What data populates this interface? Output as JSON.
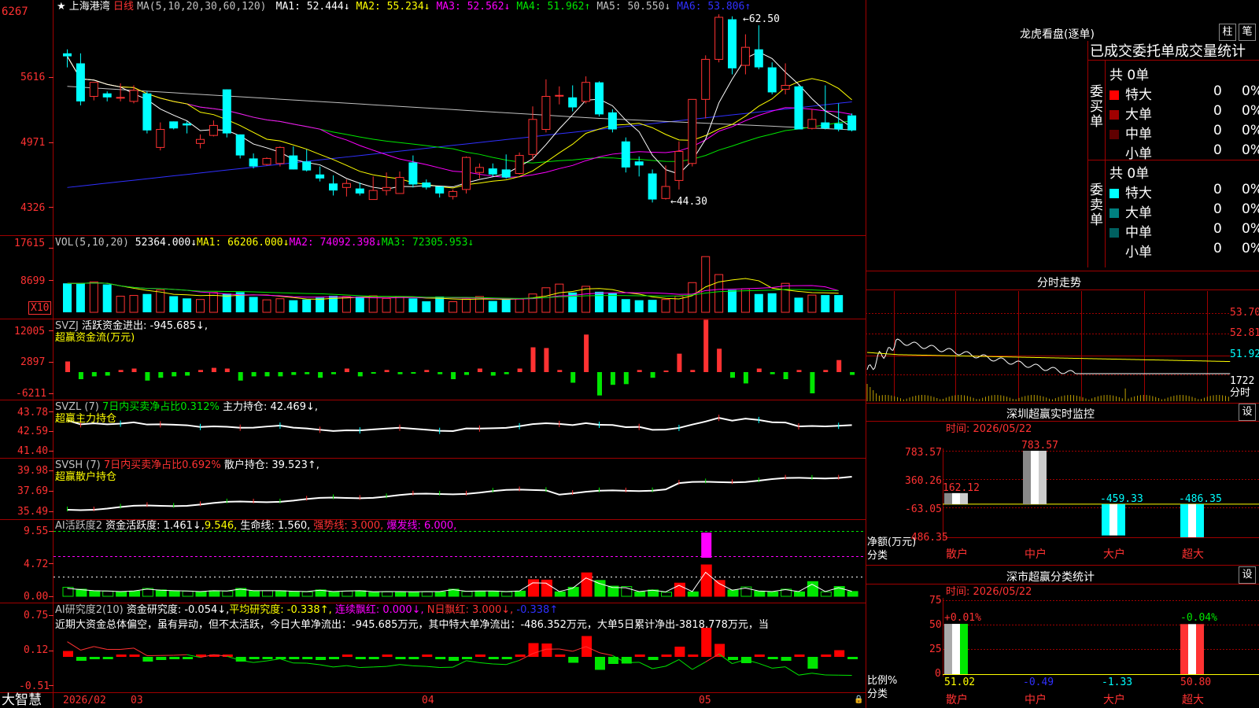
{
  "stock": {
    "name": "上海港湾",
    "star": "★",
    "period": "日线"
  },
  "ma_header": {
    "label": "MA(5,10,20,30,60,120)",
    "items": [
      {
        "text": "MA1: 52.444↓",
        "color": "#ffffff"
      },
      {
        "text": "MA2: 55.234↓",
        "color": "#ffff00"
      },
      {
        "text": "MA3: 52.562↓",
        "color": "#ff00ff"
      },
      {
        "text": "MA4: 51.962↑",
        "color": "#00e600"
      },
      {
        "text": "MA5: 50.550↓",
        "color": "#c0c0c0"
      },
      {
        "text": "MA6: 53.806↑",
        "color": "#3030ff"
      }
    ]
  },
  "price_axis": [
    "6267",
    "5616",
    "4971",
    "4326"
  ],
  "price_marks": {
    "high": "62.50",
    "low": "44.30"
  },
  "vol_header": {
    "label": "VOL(5,10,20)",
    "value": "52364.000↓",
    "ma1": "MA1: 66206.000↓",
    "ma2": "MA2: 74092.398↓",
    "ma3": "MA3: 72305.953↓"
  },
  "vol_axis": [
    "17615",
    "8699"
  ],
  "vol_unit": "X10",
  "svzj": {
    "label": "SVZJ",
    "text": "活跃资金进出: -945.685↓,",
    "title": "超赢资金流(万元)",
    "axis": [
      "12005",
      "2897",
      "-6211"
    ]
  },
  "svzl": {
    "label": "SVZL (7)",
    "ratio": "7日内买卖净占比0.312%",
    "pos": "主力持仓: 42.469↓,",
    "title": "超赢主力持仓",
    "axis": [
      "43.78",
      "42.59",
      "41.40"
    ]
  },
  "svsh": {
    "label": "SVSH (7)",
    "ratio": "7日内买卖净占比0.692%",
    "pos": "散户持仓: 39.523↑,",
    "title": "超赢散户持仓",
    "axis": [
      "39.98",
      "37.69",
      "35.49"
    ]
  },
  "ai_act": {
    "label": "AI活跃度2",
    "a": "资金活跃度: 1.461↓,",
    "b": "9.546,",
    "c": "生命线: 1.560,",
    "d": "强势线: 3.000,",
    "e": "爆发线: 6.000,",
    "axis": [
      "9.55",
      "4.72",
      "0.00"
    ]
  },
  "ai_res": {
    "label": "AI研究度2(10)",
    "a": "资金研究度: -0.054↓,",
    "b": "平均研究度: -0.338↑,",
    "c": "连续飘红: 0.000↓,",
    "d": "N日飘红: 3.000↓,",
    "e": "-0.338↑",
    "axis": [
      "0.75",
      "0.12",
      "-0.51"
    ],
    "note": "近期大资金总体偏空，虽有异动，但不太活跃，今日大单净流出：-945.685万元，其中特大单净流出：-486.352万元，大单5日累计净出-3818.778万元，当"
  },
  "bottom": {
    "brand": "大智慧",
    "dates": [
      "2026/02",
      "03",
      "04",
      "05"
    ]
  },
  "longhu": {
    "title": "龙虎看盘(逐单)",
    "btn1": "柱",
    "btn2": "笔",
    "subtitle": "已成交委托单成交量统计",
    "buy": {
      "side": "委买单",
      "total": "共 0单",
      "rows": [
        {
          "name": "特大",
          "count": "0",
          "pct": "0%",
          "color": "#ff0000"
        },
        {
          "name": "大单",
          "count": "0",
          "pct": "0%",
          "color": "#a00000"
        },
        {
          "name": "中单",
          "count": "0",
          "pct": "0%",
          "color": "#600000"
        },
        {
          "name": "小单",
          "count": "0",
          "pct": "0%",
          "color": "#000000"
        }
      ]
    },
    "sell": {
      "side": "委卖单",
      "total": "共 0单",
      "rows": [
        {
          "name": "特大",
          "count": "0",
          "pct": "0%",
          "color": "#00ffff"
        },
        {
          "name": "大单",
          "count": "0",
          "pct": "0%",
          "color": "#008080"
        },
        {
          "name": "中单",
          "count": "0",
          "pct": "0%",
          "color": "#006060"
        },
        {
          "name": "小单",
          "count": "0",
          "pct": "0%",
          "color": "#000000"
        }
      ]
    }
  },
  "fenshi": {
    "title": "分时走势",
    "axis": [
      "53.70",
      "52.81",
      "51.92",
      "1722",
      "分时"
    ]
  },
  "monitor": {
    "title": "深圳超赢实时监控",
    "btn": "设",
    "time": "时间: 2026/05/22",
    "axis": [
      "783.57",
      "360.26",
      "-63.05",
      "-486.35"
    ],
    "ylabel": "净额(万元)",
    "xlabel": "分类",
    "bars": [
      {
        "cat": "散户",
        "value": 162.12,
        "label": "162.12"
      },
      {
        "cat": "中户",
        "value": 783.57,
        "label": "783.57"
      },
      {
        "cat": "大户",
        "value": -459.33,
        "label": "-459.33"
      },
      {
        "cat": "超大",
        "value": -486.35,
        "label": "-486.35"
      }
    ]
  },
  "classstat": {
    "title": "深市超赢分类统计",
    "btn": "设",
    "time": "时间: 2026/05/22",
    "axis": [
      "75",
      "50",
      "25",
      "0"
    ],
    "ylabel": "比例%",
    "xlabel": "分类",
    "top": [
      {
        "cat": "散户",
        "label": "+0.01%"
      },
      {
        "cat": "超大",
        "label": "-0.04%"
      }
    ],
    "bars": [
      {
        "cat": "散户",
        "value": 51.02,
        "label": "51.02"
      },
      {
        "cat": "中户",
        "value": -0.49,
        "label": "-0.49"
      },
      {
        "cat": "大户",
        "value": -1.33,
        "label": "-1.33"
      },
      {
        "cat": "超大",
        "value": 50.8,
        "label": "50.80"
      }
    ]
  },
  "chart_data": {
    "type": "candlestick",
    "candles": [
      {
        "o": 58.6,
        "c": 58.3,
        "h": 59.0,
        "l": 57.2
      },
      {
        "o": 57.6,
        "c": 53.8,
        "h": 58.6,
        "l": 53.4
      },
      {
        "o": 54.3,
        "c": 55.7,
        "h": 55.7,
        "l": 53.9
      },
      {
        "o": 54.6,
        "c": 54.2,
        "h": 54.8,
        "l": 53.8
      },
      {
        "o": 54.2,
        "c": 54.2,
        "h": 55.6,
        "l": 53.8
      },
      {
        "o": 53.8,
        "c": 54.9,
        "h": 55.4,
        "l": 53.6
      },
      {
        "o": 54.6,
        "c": 50.9,
        "h": 54.8,
        "l": 50.6
      },
      {
        "o": 49.2,
        "c": 51.0,
        "h": 51.7,
        "l": 48.9
      },
      {
        "o": 51.8,
        "c": 51.1,
        "h": 51.8,
        "l": 51.0
      },
      {
        "o": 51.6,
        "c": 51.4,
        "h": 51.8,
        "l": 50.6
      },
      {
        "o": 49.6,
        "c": 50.0,
        "h": 50.5,
        "l": 49.1
      },
      {
        "o": 50.4,
        "c": 51.4,
        "h": 51.9,
        "l": 50.3
      },
      {
        "o": 55.0,
        "c": 50.6,
        "h": 55.0,
        "l": 50.2
      },
      {
        "o": 50.5,
        "c": 48.4,
        "h": 50.5,
        "l": 48.1
      },
      {
        "o": 48.1,
        "c": 47.3,
        "h": 48.6,
        "l": 47.1
      },
      {
        "o": 47.5,
        "c": 48.1,
        "h": 48.2,
        "l": 47.4
      },
      {
        "o": 47.6,
        "c": 49.2,
        "h": 49.3,
        "l": 47.3
      },
      {
        "o": 48.4,
        "c": 47.0,
        "h": 49.3,
        "l": 47.0
      },
      {
        "o": 47.8,
        "c": 46.9,
        "h": 49.0,
        "l": 46.8
      },
      {
        "o": 46.5,
        "c": 46.1,
        "h": 47.3,
        "l": 45.8
      },
      {
        "o": 45.6,
        "c": 44.9,
        "h": 46.4,
        "l": 44.4
      },
      {
        "o": 45.2,
        "c": 45.6,
        "h": 46.0,
        "l": 44.3
      },
      {
        "o": 45.1,
        "c": 44.6,
        "h": 45.7,
        "l": 44.4
      },
      {
        "o": 44.0,
        "c": 44.9,
        "h": 46.3,
        "l": 44.0
      },
      {
        "o": 44.9,
        "c": 45.2,
        "h": 46.7,
        "l": 44.4
      },
      {
        "o": 44.6,
        "c": 46.2,
        "h": 46.8,
        "l": 44.6
      },
      {
        "o": 47.7,
        "c": 45.5,
        "h": 48.4,
        "l": 45.2
      },
      {
        "o": 45.7,
        "c": 45.2,
        "h": 46.0,
        "l": 45.0
      },
      {
        "o": 45.3,
        "c": 44.6,
        "h": 45.3,
        "l": 44.2
      },
      {
        "o": 44.3,
        "c": 44.8,
        "h": 45.0,
        "l": 44.0
      },
      {
        "o": 45.0,
        "c": 48.2,
        "h": 48.3,
        "l": 44.6
      },
      {
        "o": 46.7,
        "c": 47.2,
        "h": 47.6,
        "l": 46.1
      },
      {
        "o": 47.1,
        "c": 46.5,
        "h": 47.6,
        "l": 46.3
      },
      {
        "o": 47.0,
        "c": 46.2,
        "h": 48.5,
        "l": 46.1
      },
      {
        "o": 46.6,
        "c": 48.4,
        "h": 48.7,
        "l": 46.5
      },
      {
        "o": 48.5,
        "c": 52.0,
        "h": 53.3,
        "l": 47.9
      },
      {
        "o": 51.0,
        "c": 54.3,
        "h": 56.0,
        "l": 50.7
      },
      {
        "o": 54.4,
        "c": 54.4,
        "h": 55.3,
        "l": 53.5
      },
      {
        "o": 54.2,
        "c": 53.2,
        "h": 55.4,
        "l": 52.8
      },
      {
        "o": 53.8,
        "c": 55.7,
        "h": 56.3,
        "l": 53.6
      },
      {
        "o": 55.7,
        "c": 52.5,
        "h": 55.8,
        "l": 52.3
      },
      {
        "o": 52.7,
        "c": 51.0,
        "h": 53.0,
        "l": 50.7
      },
      {
        "o": 49.8,
        "c": 47.2,
        "h": 50.2,
        "l": 46.7
      },
      {
        "o": 47.8,
        "c": 47.4,
        "h": 48.3,
        "l": 46.3
      },
      {
        "o": 46.6,
        "c": 44.0,
        "h": 47.0,
        "l": 43.7
      },
      {
        "o": 44.1,
        "c": 45.3,
        "h": 47.4,
        "l": 44.0
      },
      {
        "o": 45.9,
        "c": 48.8,
        "h": 49.8,
        "l": 45.0
      },
      {
        "o": 47.6,
        "c": 54.0,
        "h": 54.0,
        "l": 47.3
      },
      {
        "o": 54.0,
        "c": 58.0,
        "h": 58.4,
        "l": 52.1
      },
      {
        "o": 58.0,
        "c": 62.2,
        "h": 62.5,
        "l": 57.7
      },
      {
        "o": 62.0,
        "c": 57.1,
        "h": 62.3,
        "l": 56.5
      },
      {
        "o": 57.4,
        "c": 59.2,
        "h": 60.5,
        "l": 56.5
      },
      {
        "o": 59.0,
        "c": 57.2,
        "h": 61.4,
        "l": 57.0
      },
      {
        "o": 57.2,
        "c": 54.7,
        "h": 57.7,
        "l": 54.5
      },
      {
        "o": 55.0,
        "c": 55.4,
        "h": 57.6,
        "l": 54.5
      },
      {
        "o": 55.3,
        "c": 51.0,
        "h": 55.4,
        "l": 51.0
      },
      {
        "o": 51.1,
        "c": 52.0,
        "h": 53.0,
        "l": 51.0
      },
      {
        "o": 51.7,
        "c": 51.1,
        "h": 55.4,
        "l": 51.0
      },
      {
        "o": 51.6,
        "c": 51.0,
        "h": 53.6,
        "l": 50.8
      },
      {
        "o": 52.4,
        "c": 50.9,
        "h": 52.6,
        "l": 50.8
      }
    ],
    "volume": [
      7.9,
      7.9,
      8.3,
      7.6,
      4.4,
      4.6,
      5.0,
      6.1,
      4.4,
      3.8,
      3.5,
      5.4,
      5.1,
      5.5,
      4.2,
      3.4,
      3.7,
      3.3,
      3.5,
      4.0,
      4.5,
      4.3,
      4.3,
      4.5,
      3.8,
      4.3,
      3.8,
      3.0,
      4.3,
      2.9,
      3.6,
      4.3,
      3.1,
      3.7,
      3.6,
      5.0,
      6.7,
      7.7,
      5.4,
      7.1,
      5.6,
      5.2,
      3.6,
      3.3,
      3.4,
      3.5,
      4.4,
      8.1,
      15.2,
      10.3,
      6.1,
      6.4,
      5.0,
      5.2,
      7.9,
      4.0,
      4.7,
      4.7,
      4.7
    ],
    "zj": [
      1.5,
      -1,
      -0.6,
      -0.5,
      0.3,
      0.5,
      -1.2,
      -0.8,
      -0.6,
      -0.5,
      0.3,
      0.6,
      0.5,
      -1.2,
      -0.6,
      -0.6,
      -0.6,
      -0.4,
      -0.3,
      -0.8,
      -0.3,
      0.5,
      -0.6,
      -0.2,
      0.3,
      -0.3,
      -0.2,
      0.3,
      -0.3,
      -1,
      -0.4,
      0.5,
      -0.5,
      -0.3,
      0.5,
      3.5,
      3.4,
      0.3,
      -1.5,
      5.3,
      -3.3,
      -1.8,
      -1.7,
      0.3,
      -0.8,
      0.2,
      2.6,
      0.3,
      7.4,
      3.3,
      -0.8,
      -1.6,
      0.5,
      -0.3,
      -1,
      0.3,
      -3,
      0.3,
      1.7,
      -0.4
    ]
  }
}
